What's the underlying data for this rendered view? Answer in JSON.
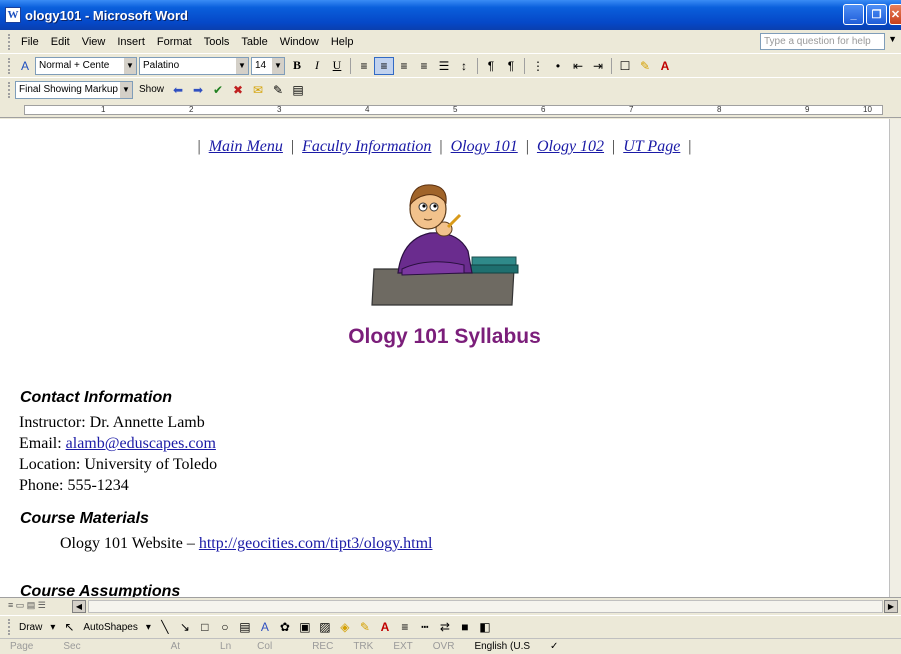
{
  "window": {
    "title": "ology101 - Microsoft Word",
    "icon": "word-doc-icon"
  },
  "menubar": {
    "items": [
      "File",
      "Edit",
      "View",
      "Insert",
      "Format",
      "Tools",
      "Table",
      "Window",
      "Help"
    ],
    "help_placeholder": "Type a question for help"
  },
  "formatting": {
    "style": "Normal + Cente",
    "font": "Palatino",
    "size": "14"
  },
  "reviewing": {
    "display": "Final Showing Markup",
    "show_label": "Show"
  },
  "ruler": {
    "numbers": [
      "1",
      "2",
      "3",
      "4",
      "5",
      "6",
      "7",
      "8",
      "9",
      "10"
    ]
  },
  "document": {
    "nav": [
      "Main Menu",
      "Faculty Information",
      "Ology 101",
      "Ology 102",
      "UT Page"
    ],
    "title": "Ology 101 Syllabus",
    "contact_heading": "Contact Information",
    "instructor": "Instructor: Dr. Annette Lamb",
    "email_label": "Email: ",
    "email": "alamb@eduscapes.com",
    "location": "Location: University of Toledo",
    "phone": "Phone: 555-1234",
    "materials_heading": "Course Materials",
    "website_label": "Ology 101 Website – ",
    "website_url": "http://geocities.com/tipt3/ology.html",
    "assumptions_heading": "Course Assumptions"
  },
  "drawbar": {
    "draw_label": "Draw",
    "autoshapes_label": "AutoShapes"
  },
  "status": {
    "page": "Page",
    "sec": "Sec",
    "at": "At",
    "ln": "Ln",
    "col": "Col",
    "rec": "REC",
    "trk": "TRK",
    "ext": "EXT",
    "ovr": "OVR",
    "language": "English (U.S"
  },
  "colors": {
    "title_purple": "#7b1e7a",
    "link_blue": "#1a1aa6"
  }
}
